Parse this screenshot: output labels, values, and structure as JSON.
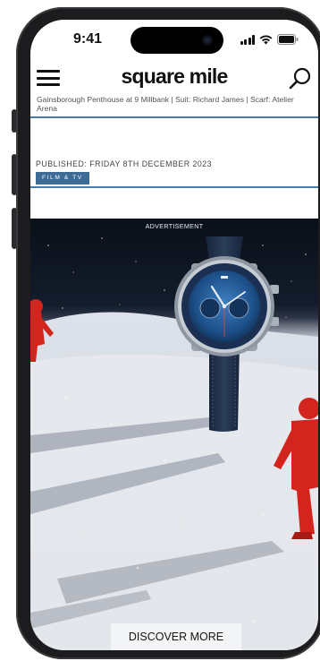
{
  "status_bar": {
    "time": "9:41"
  },
  "header": {
    "logo": "square mile",
    "menu_icon": "hamburger-menu-icon",
    "search_icon": "search-icon"
  },
  "article": {
    "caption": "Gainsborough Penthouse at 9 Millbank | Suit: Richard James | Scarf: Atelier Arena",
    "published": "PUBLISHED: FRIDAY 8TH DECEMBER 2023",
    "tag": "FILM & TV"
  },
  "advertisement": {
    "label": "ADVERTISEMENT",
    "cta": "DISCOVER MORE"
  },
  "colors": {
    "accent": "#3e6b96",
    "rule": "#4b7aa6"
  }
}
